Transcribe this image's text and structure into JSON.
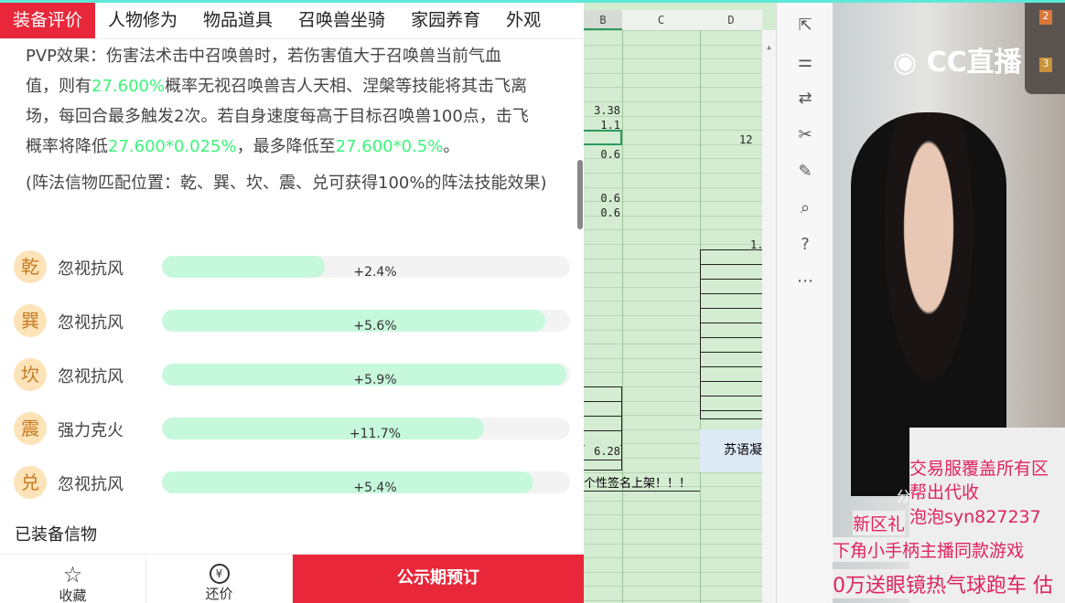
{
  "tabs": [
    "装备评价",
    "人物修为",
    "物品道具",
    "召唤兽坐骑",
    "家园养育",
    "外观"
  ],
  "description": {
    "l1": "PVP效果：伤害法术击中召唤兽时，若伤害值大于召唤兽当前气血",
    "l2a": "值，则有",
    "l2g": "27.600%",
    "l2b": "概率无视召唤兽吉人天相、涅槃等技能将其击飞离",
    "l3": "场，每回合最多触发2次。若自身速度每高于目标召唤兽100点，击飞",
    "l4a": "概率将降低",
    "l4g": "27.600*0.025%",
    "l4b": "，最多降低至",
    "l4g2": "27.600*0.5%",
    "l4c": "。",
    "note": "(阵法信物匹配位置：乾、巽、坎、震、兑可获得100%的阵法技能效果)"
  },
  "accent_green": "#3cf57a",
  "attributes": [
    {
      "badge": "乾",
      "label": "忽视抗风",
      "value": "+2.4%",
      "fill": 0.4
    },
    {
      "badge": "巽",
      "label": "忽视抗风",
      "value": "+5.6%",
      "fill": 0.94
    },
    {
      "badge": "坎",
      "label": "忽视抗风",
      "value": "+5.9%",
      "fill": 0.99
    },
    {
      "badge": "震",
      "label": "强力克火",
      "value": "+11.7%",
      "fill": 0.79
    },
    {
      "badge": "兑",
      "label": "忽视抗风",
      "value": "+5.4%",
      "fill": 0.91
    }
  ],
  "equipped_title": "已装备信物",
  "footer": {
    "favorite": "收藏",
    "bargain": "还价",
    "buy": "公示期预订"
  },
  "sheet": {
    "cols": [
      "B",
      "C",
      "D"
    ],
    "b_values": [
      "3.38",
      "1.1",
      "0.6",
      "0.6",
      "0.6",
      "6.28"
    ],
    "d_values": [
      "12",
      "1."
    ],
    "d_name": "苏语凝",
    "banner": "个性签名上架！！！"
  },
  "stream": {
    "logo": "CC直播",
    "rank2": "2",
    "rank3": "3",
    "overlay": [
      "交易服覆盖所有区",
      "帮出代收",
      "泡泡syn827237",
      "新区礼",
      "下角小手柄主播同款游戏",
      "0万送眼镜热气球跑车  估"
    ],
    "cut": "分"
  }
}
